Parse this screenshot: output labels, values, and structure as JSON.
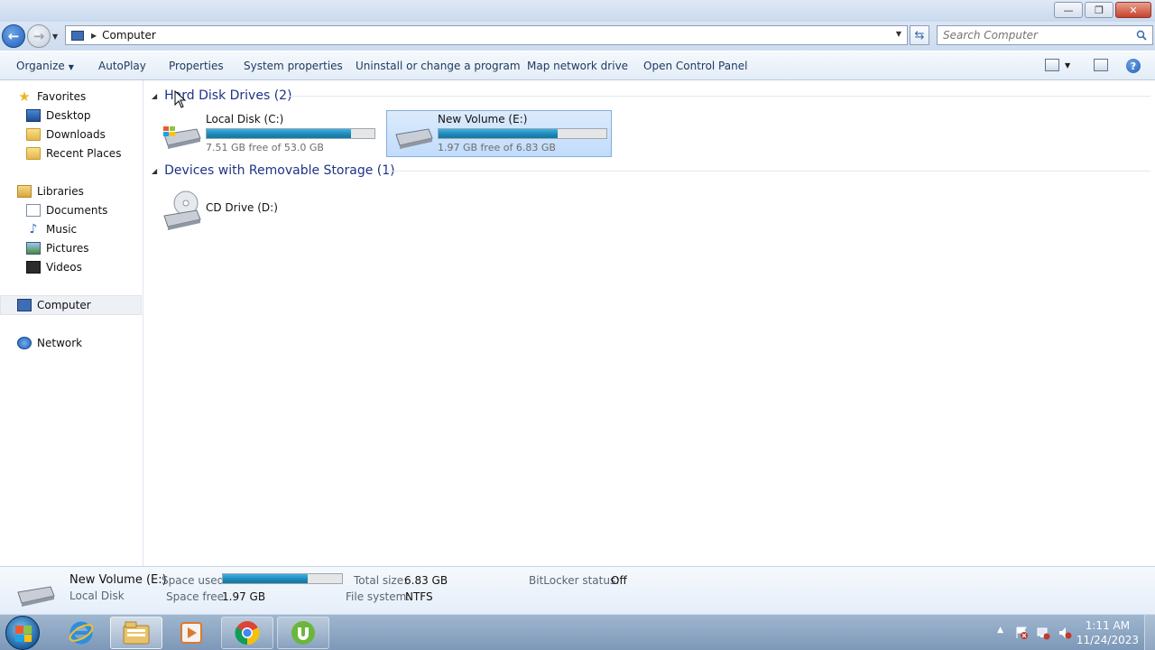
{
  "window": {
    "minimize_glyph": "—",
    "maximize_glyph": "❐",
    "close_glyph": "✕"
  },
  "nav": {
    "back_glyph": "←",
    "forward_glyph": "→",
    "address": "Computer",
    "search_placeholder": "Search Computer"
  },
  "toolbar": {
    "organize": "Organize",
    "autoplay": "AutoPlay",
    "properties": "Properties",
    "system_properties": "System properties",
    "uninstall": "Uninstall or change a program",
    "map_network_drive": "Map network drive",
    "open_control_panel": "Open Control Panel",
    "help_glyph": "?"
  },
  "sidebar": {
    "favorites": "Favorites",
    "desktop": "Desktop",
    "downloads": "Downloads",
    "recent_places": "Recent Places",
    "libraries": "Libraries",
    "documents": "Documents",
    "music": "Music",
    "pictures": "Pictures",
    "videos": "Videos",
    "computer": "Computer",
    "network": "Network"
  },
  "groups": {
    "hard_disk": "Hard Disk Drives (2)",
    "removable": "Devices with Removable Storage (1)"
  },
  "drives": [
    {
      "name": "Local Disk (C:)",
      "free_text": "7.51 GB free of 53.0 GB",
      "used_fraction": 0.858
    },
    {
      "name": "New Volume (E:)",
      "free_text": "1.97 GB free of 6.83 GB",
      "used_fraction": 0.712
    }
  ],
  "removable": {
    "name": "CD Drive (D:)"
  },
  "details": {
    "title": "New Volume (E:)",
    "subtitle": "Local Disk",
    "space_used_label": "Space used:",
    "space_used_fraction": 0.712,
    "space_free_label": "Space free:",
    "space_free_value": "1.97 GB",
    "total_size_label": "Total size:",
    "total_size_value": "6.83 GB",
    "file_system_label": "File system:",
    "file_system_value": "NTFS",
    "bitlocker_label": "BitLocker status:",
    "bitlocker_value": "Off"
  },
  "taskbar": {
    "time": "1:11 AM",
    "date": "11/24/2023",
    "apps": [
      "internet-explorer-icon",
      "windows-explorer-icon",
      "media-player-icon",
      "chrome-icon",
      "utorrent-icon"
    ]
  }
}
